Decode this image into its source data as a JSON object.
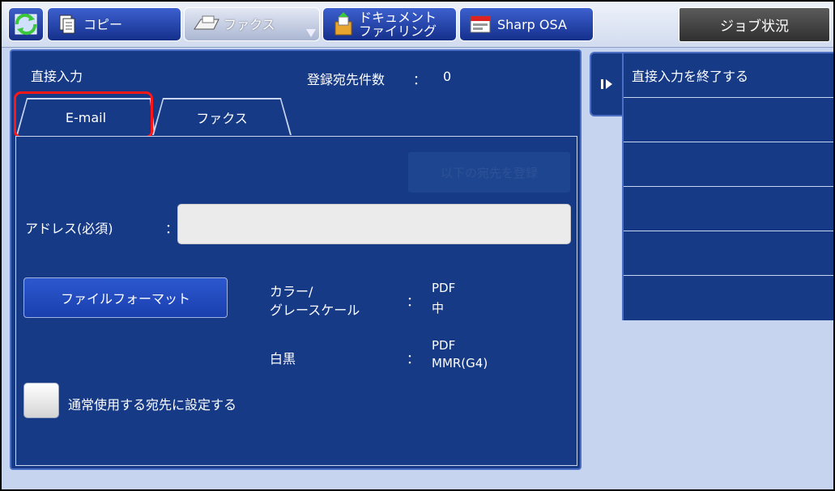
{
  "topbar": {
    "tabs": [
      {
        "label": "コピー"
      },
      {
        "label": "ファクス",
        "active": true
      },
      {
        "label_line1": "ドキュメント",
        "label_line2": "ファイリング"
      },
      {
        "label": "Sharp OSA"
      }
    ],
    "job_status_label": "ジョブ状況"
  },
  "panel": {
    "title": "直接入力",
    "registered_count_label": "登録宛先件数",
    "registered_count_sep": "：",
    "registered_count_value": "0",
    "tabs": [
      {
        "label": "E-mail",
        "selected": true
      },
      {
        "label": "ファクス"
      }
    ],
    "register_button_label": "以下の宛先を登録",
    "address_label": "アドレス(必須)",
    "address_sep": "：",
    "address_value": "",
    "file_format_button_label": "ファイルフォーマット",
    "color_label_line1": "カラー/",
    "color_label_line2": "グレースケール",
    "color_sep": "：",
    "color_value_line1": "PDF",
    "color_value_line2": "中",
    "bw_label": "白黒",
    "bw_sep": "：",
    "bw_value_line1": "PDF",
    "bw_value_line2": "MMR(G4)",
    "default_checkbox_label": "通常使用する宛先に設定する",
    "default_checked": false
  },
  "side": {
    "items": [
      {
        "label": "直接入力を終了する"
      },
      {
        "label": ""
      },
      {
        "label": ""
      },
      {
        "label": ""
      },
      {
        "label": ""
      },
      {
        "label": ""
      }
    ]
  },
  "colors": {
    "panel_bg": "#163a86",
    "highlight": "#ff1717",
    "screen_bg": "#c6d4ef"
  }
}
